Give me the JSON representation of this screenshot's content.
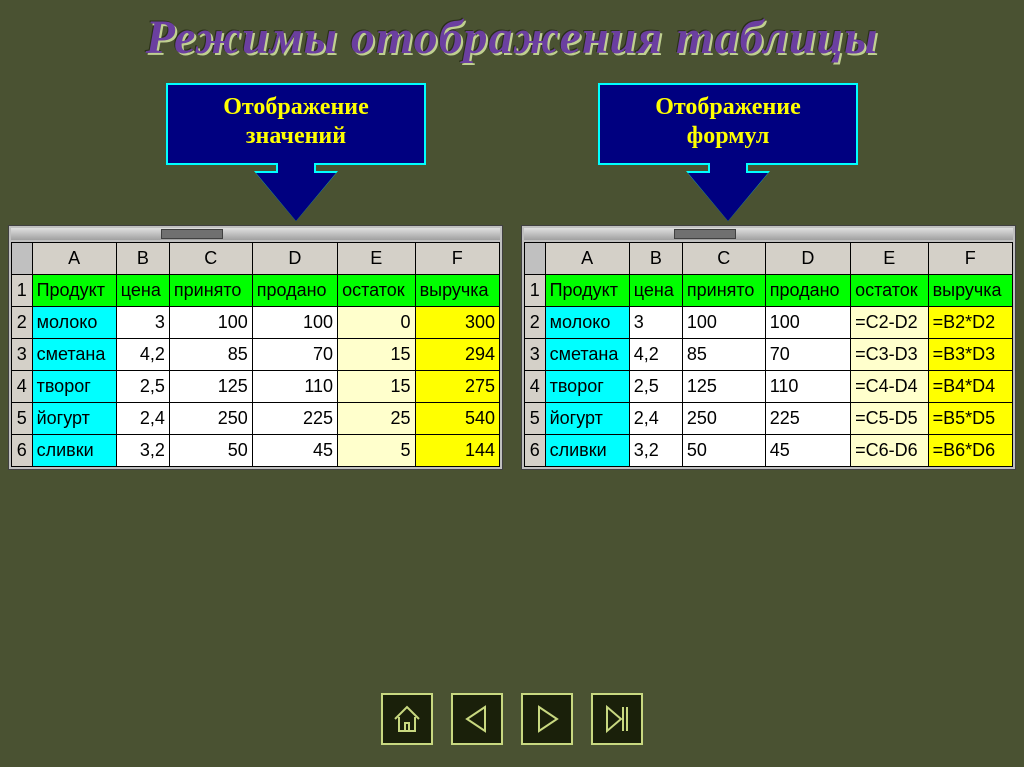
{
  "title": "Режимы отображения таблицы",
  "callout_left": {
    "line1": "Отображение",
    "line2": "значений"
  },
  "callout_right": {
    "line1": "Отображение",
    "line2": "формул"
  },
  "columns": [
    "A",
    "B",
    "C",
    "D",
    "E",
    "F"
  ],
  "row_numbers": [
    "1",
    "2",
    "3",
    "4",
    "5",
    "6"
  ],
  "headers": {
    "A": "Продукт",
    "B": "цена",
    "C": "принято",
    "D": "продано",
    "E": "остаток",
    "F": "выручка"
  },
  "left_table": {
    "rows": [
      {
        "A": "молоко",
        "B": "3",
        "C": "100",
        "D": "100",
        "E": "0",
        "F": "300"
      },
      {
        "A": "сметана",
        "B": "4,2",
        "C": "85",
        "D": "70",
        "E": "15",
        "F": "294"
      },
      {
        "A": "творог",
        "B": "2,5",
        "C": "125",
        "D": "110",
        "E": "15",
        "F": "275"
      },
      {
        "A": "йогурт",
        "B": "2,4",
        "C": "250",
        "D": "225",
        "E": "25",
        "F": "540"
      },
      {
        "A": "сливки",
        "B": "3,2",
        "C": "50",
        "D": "45",
        "E": "5",
        "F": "144"
      }
    ]
  },
  "right_table": {
    "rows": [
      {
        "A": "молоко",
        "B": "3",
        "C": "100",
        "D": "100",
        "E": "=C2-D2",
        "F": "=B2*D2"
      },
      {
        "A": "сметана",
        "B": "4,2",
        "C": "85",
        "D": "70",
        "E": "=C3-D3",
        "F": "=B3*D3"
      },
      {
        "A": "творог",
        "B": "2,5",
        "C": "125",
        "D": "110",
        "E": "=C4-D4",
        "F": "=B4*D4"
      },
      {
        "A": "йогурт",
        "B": "2,4",
        "C": "250",
        "D": "225",
        "E": "=C5-D5",
        "F": "=B5*D5"
      },
      {
        "A": "сливки",
        "B": "3,2",
        "C": "50",
        "D": "45",
        "E": "=C6-D6",
        "F": "=B6*D6"
      }
    ]
  },
  "nav": {
    "home": "home-icon",
    "prev": "prev-icon",
    "next": "next-icon",
    "last": "last-icon"
  }
}
